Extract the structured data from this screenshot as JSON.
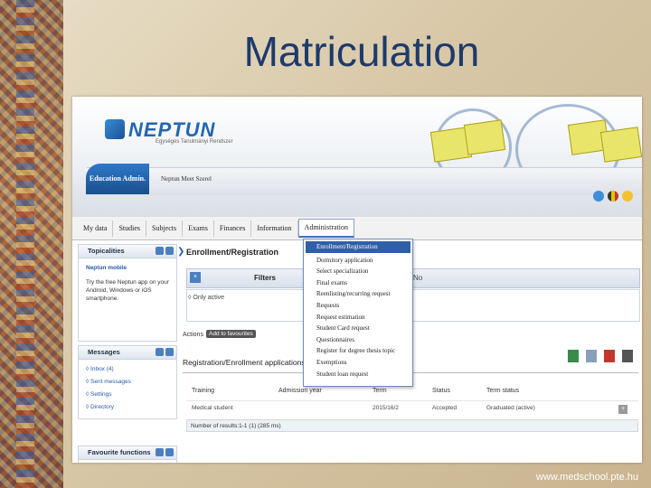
{
  "slide": {
    "title": "Matriculation",
    "footer": "www.medschool.pte.hu"
  },
  "neptun": {
    "logo": "NEPTUN",
    "logo_sub": "Egységes Tanulmányi Rendszer",
    "role_tab": "Education Admin.",
    "user_name": "Neptun Meet Szerel",
    "nav": [
      "My data",
      "Studies",
      "Subjects",
      "Exams",
      "Finances",
      "Information",
      "Administration"
    ],
    "panels": {
      "topicalities": {
        "title": "Topicalities",
        "link": "Neptun mobile",
        "text": "Try the free Neptun app on your Android, Windows or iOS smartphone."
      },
      "messages": {
        "title": "Messages",
        "items": [
          "Inbox (4)",
          "Sent messages",
          "Settings",
          "Directory"
        ]
      },
      "favourites": {
        "title": "Favourite functions"
      }
    },
    "main": {
      "breadcrumb": "Enrollment/Registration",
      "filters_label": "Filters",
      "no_label": "No",
      "only_active": "Only active",
      "actions_label": "Actions",
      "add_favourites": "Add to favourites",
      "section_title": "Registration/Enrollment applications",
      "table_headers": [
        "Training",
        "Admission year",
        "Term",
        "Status",
        "Term status"
      ],
      "row": [
        "Medical student",
        "",
        "2015/16/2",
        "Accepted",
        "Graduated (active)"
      ],
      "result_count": "Number of results:1-1 (1) (285 ms)"
    },
    "dropdown": [
      "Enrollment/Registration",
      "Dormitory application",
      "Select specialization",
      "Final exams",
      "Reenlisting/recurring request",
      "Requests",
      "Request estimation",
      "Student Card request",
      "Questionnaires",
      "Register for degree thesis topic",
      "Exemptions",
      "Student loan request"
    ]
  }
}
